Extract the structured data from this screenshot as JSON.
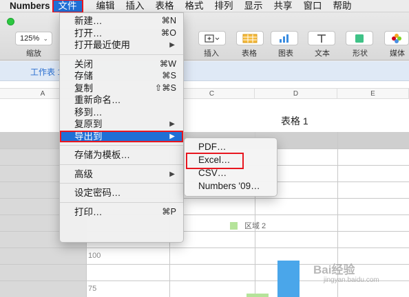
{
  "menubar": {
    "app_name": "Numbers",
    "items": [
      "文件",
      "编辑",
      "插入",
      "表格",
      "格式",
      "排列",
      "显示",
      "共享",
      "窗口",
      "帮助"
    ]
  },
  "toolbar": {
    "zoom_value": "125%",
    "zoom_label": "缩放",
    "insert_label": "插入",
    "table_label": "表格",
    "chart_label": "图表",
    "text_label": "文本",
    "shape_label": "形状",
    "media_label": "媒体"
  },
  "sheet_tab": {
    "label": "工作表 1"
  },
  "columns": [
    "A",
    "C",
    "D",
    "E"
  ],
  "table_title": "表格 1",
  "chart": {
    "legend": "区域 2",
    "ticks": [
      "100",
      "75"
    ]
  },
  "file_menu": {
    "new": {
      "label": "新建…",
      "shortcut": "⌘N"
    },
    "open": {
      "label": "打开…",
      "shortcut": "⌘O"
    },
    "open_recent": {
      "label": "打开最近使用"
    },
    "close": {
      "label": "关闭",
      "shortcut": "⌘W"
    },
    "save": {
      "label": "存储",
      "shortcut": "⌘S"
    },
    "duplicate": {
      "label": "复制",
      "shortcut": "⇧⌘S"
    },
    "rename": {
      "label": "重新命名…"
    },
    "move_to": {
      "label": "移到…"
    },
    "revert_to": {
      "label": "复原到"
    },
    "export_to": {
      "label": "导出到"
    },
    "save_as_template": {
      "label": "存储为模板…"
    },
    "advanced": {
      "label": "高级"
    },
    "set_password": {
      "label": "设定密码…"
    },
    "print": {
      "label": "打印…",
      "shortcut": "⌘P"
    }
  },
  "export_submenu": [
    "PDF…",
    "Excel…",
    "CSV…",
    "Numbers '09…"
  ],
  "watermark": {
    "text": "Bai经验",
    "url": "jingyan.baidu.com"
  },
  "colors": {
    "highlight": "#1f6fd6",
    "annotation": "#e8161f",
    "chart_blue": "#4aa6ea",
    "chart_green": "#b5e39a"
  }
}
